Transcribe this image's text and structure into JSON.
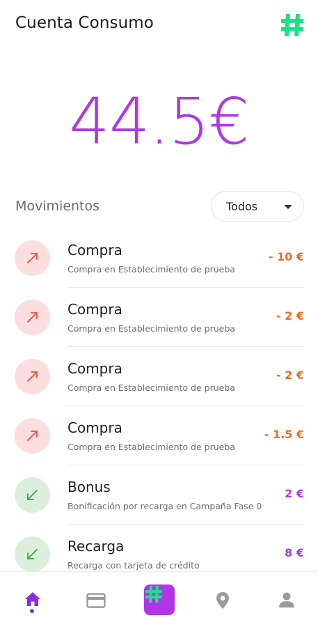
{
  "header": {
    "title": "Cuenta Consumo",
    "logo_icon": "hashtag-logo-icon",
    "logo_color": "#1ee08a"
  },
  "balance": {
    "amount": "44.5€",
    "color": "#b037e8"
  },
  "movements": {
    "title": "Movimientos",
    "filter": {
      "selected": "Todos"
    },
    "items": [
      {
        "type": "out",
        "title": "Compra",
        "subtitle": "Compra en Establecimiento de prueba",
        "amount": "- 10 €"
      },
      {
        "type": "out",
        "title": "Compra",
        "subtitle": "Compra en Establecimiento de prueba",
        "amount": "- 2 €"
      },
      {
        "type": "out",
        "title": "Compra",
        "subtitle": "Compra en Establecimiento de prueba",
        "amount": "- 2 €"
      },
      {
        "type": "out",
        "title": "Compra",
        "subtitle": "Compra en Establecimiento de prueba",
        "amount": "- 1.5 €"
      },
      {
        "type": "in",
        "title": "Bonus",
        "subtitle": "Bonificación por recarga en Campaña Fase 0",
        "amount": "2 €"
      },
      {
        "type": "in",
        "title": "Recarga",
        "subtitle": "Recarga con tarjeta de crédito",
        "amount": "8 €"
      }
    ]
  },
  "bottom_nav": {
    "items": [
      "home-icon",
      "card-icon",
      "hashtag-icon",
      "location-pin-icon",
      "person-icon"
    ],
    "active": "home-icon",
    "active_color": "#8b2ee0",
    "inactive_color": "#9a9a9a"
  }
}
